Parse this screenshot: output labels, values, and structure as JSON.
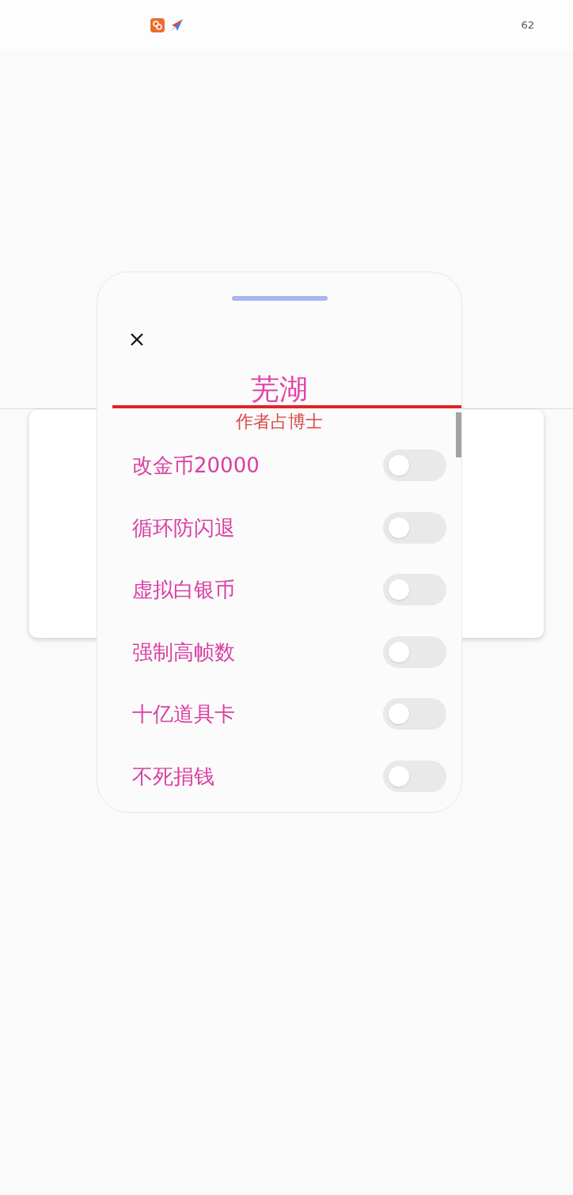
{
  "status_bar": {
    "battery": "62"
  },
  "dialog": {
    "title": "芜湖",
    "subtitle": "作者占博士",
    "items": [
      {
        "label": "改金币20000",
        "on": false
      },
      {
        "label": "循环防闪退",
        "on": false
      },
      {
        "label": "虚拟白银币",
        "on": false
      },
      {
        "label": "强制高帧数",
        "on": false
      },
      {
        "label": "十亿道具卡",
        "on": false
      },
      {
        "label": "不死捐钱",
        "on": false
      }
    ]
  }
}
